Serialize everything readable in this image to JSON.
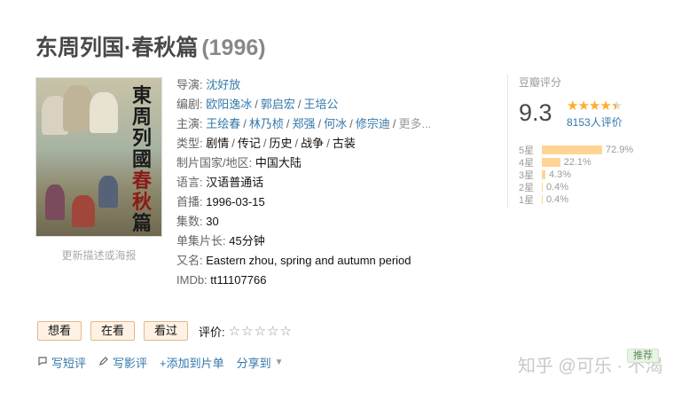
{
  "title": {
    "name": "东周列国·春秋篇",
    "year": "(1996)"
  },
  "poster": {
    "calligraphy": [
      "東",
      "周",
      "列",
      "國",
      "春",
      "秋",
      "篇"
    ],
    "caption": "更新描述或海报"
  },
  "info": {
    "director": {
      "label": "导演:",
      "names": [
        "沈好放"
      ]
    },
    "writer": {
      "label": "编剧:",
      "names": [
        "欧阳逸冰",
        "郭启宏",
        "王培公"
      ]
    },
    "cast": {
      "label": "主演:",
      "names": [
        "王绘春",
        "林乃桢",
        "郑强",
        "何冰",
        "修宗迪"
      ],
      "more": "更多..."
    },
    "genre": {
      "label": "类型:",
      "values": [
        "剧情",
        "传记",
        "历史",
        "战争",
        "古装"
      ]
    },
    "country": {
      "label": "制片国家/地区:",
      "value": "中国大陆"
    },
    "language": {
      "label": "语言:",
      "value": "汉语普通话"
    },
    "premiere": {
      "label": "首播:",
      "value": "1996-03-15"
    },
    "episodes": {
      "label": "集数:",
      "value": "30"
    },
    "runtime": {
      "label": "单集片长:",
      "value": "45分钟"
    },
    "aka": {
      "label": "又名:",
      "value": "Eastern zhou, spring and autumn period"
    },
    "imdb": {
      "label": "IMDb:",
      "value": "tt11107766"
    }
  },
  "rating": {
    "header": "豆瓣评分",
    "score": "9.3",
    "stars_value": 4.5,
    "count": "8153人评价",
    "distribution": [
      {
        "label": "5星",
        "pct": "72.9%",
        "value": 72.9
      },
      {
        "label": "4星",
        "pct": "22.1%",
        "value": 22.1
      },
      {
        "label": "3星",
        "pct": "4.3%",
        "value": 4.3
      },
      {
        "label": "2星",
        "pct": "0.4%",
        "value": 0.4
      },
      {
        "label": "1星",
        "pct": "0.4%",
        "value": 0.4
      }
    ],
    "bar_color": "#ffd596",
    "star_color": "#ffac2d"
  },
  "actions": {
    "want": "想看",
    "watching": "在看",
    "watched": "看过",
    "rate_label": "评价:",
    "empty_stars": "☆☆☆☆☆"
  },
  "links": {
    "short_review": "写短评",
    "review": "写影评",
    "add_list": "+添加到片单",
    "share": "分享到"
  },
  "watermark": "知乎 @可乐 · 不渴",
  "badge": "推荐",
  "colors": {
    "link": "#3377aa",
    "title": "#494949"
  }
}
